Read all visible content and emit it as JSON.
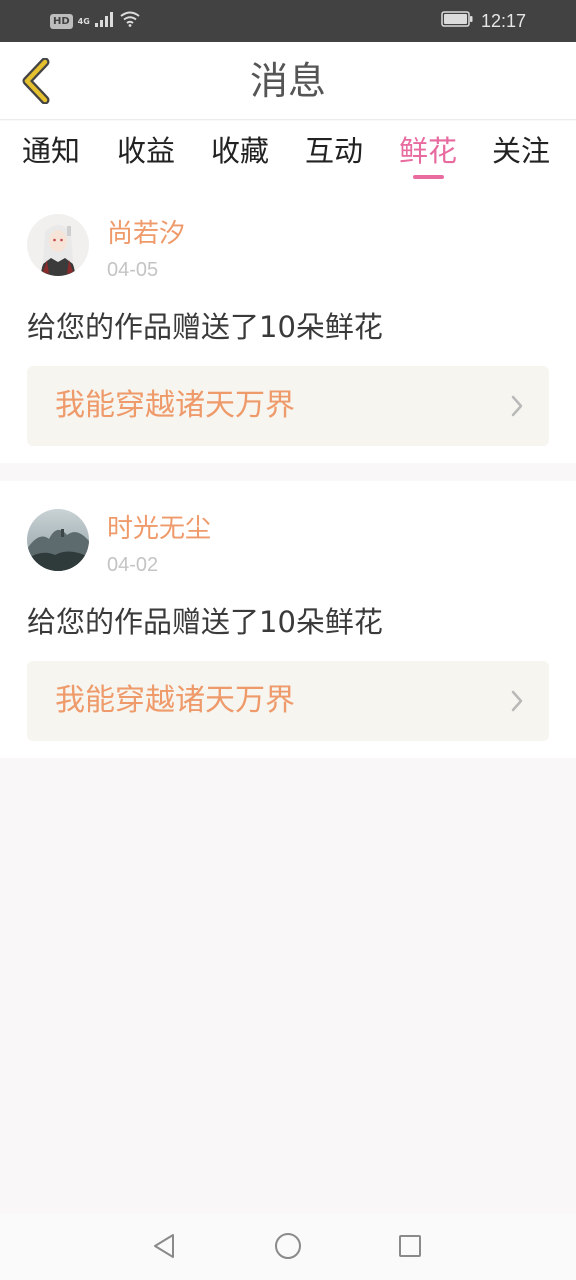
{
  "status_bar": {
    "hd_label": "HD",
    "network_label": "4G",
    "time": "12:17",
    "icons": [
      "signal-icon",
      "wifi-icon",
      "battery-icon"
    ]
  },
  "header": {
    "back_icon": "chevron-left-icon",
    "title": "消息",
    "accent_color": "#e5c02f"
  },
  "tabs": {
    "items": [
      {
        "label": "通知"
      },
      {
        "label": "收益"
      },
      {
        "label": "收藏"
      },
      {
        "label": "互动"
      },
      {
        "label": "鲜花"
      },
      {
        "label": "关注"
      }
    ],
    "active_index": 4,
    "active_color": "#e86ba0"
  },
  "messages": [
    {
      "user": "尚若汐",
      "date": "04-05",
      "text": "给您的作品赠送了10朵鲜花",
      "book_title": "我能穿越诸天万界",
      "avatar": "anime-character-avatar"
    },
    {
      "user": "时光无尘",
      "date": "04-02",
      "text": "给您的作品赠送了10朵鲜花",
      "book_title": "我能穿越诸天万界",
      "avatar": "landscape-avatar"
    }
  ],
  "navbar": {
    "icons": [
      "back-triangle-icon",
      "home-circle-icon",
      "recents-square-icon"
    ]
  },
  "colors": {
    "username": "#ef9a6a",
    "book_title": "#ef9a6a",
    "link_background": "#f6f5ef"
  }
}
